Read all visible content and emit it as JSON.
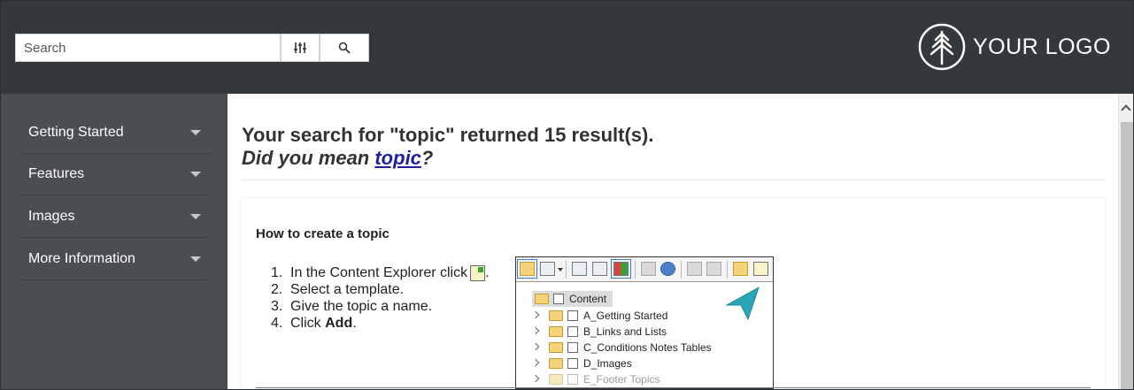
{
  "header": {
    "search": {
      "placeholder": "Search"
    },
    "logo_text": "YOUR LOGO",
    "icons": {
      "filter": "sliders-icon",
      "search": "search-icon",
      "logo": "tree-logo-icon"
    }
  },
  "sidebar": {
    "items": [
      {
        "label": "Getting Started"
      },
      {
        "label": "Features"
      },
      {
        "label": "Images"
      },
      {
        "label": "More Information"
      }
    ]
  },
  "results": {
    "heading": "Your search for \"topic\" returned 15 result(s).",
    "did_you_mean_prefix": "Did you mean ",
    "did_you_mean_term": "topic",
    "did_you_mean_suffix": "?",
    "card": {
      "title": "How to create a topic",
      "steps": [
        {
          "num": "1.",
          "text": "In the Content Explorer click"
        },
        {
          "num": "2.",
          "text": "Select a template."
        },
        {
          "num": "3.",
          "text": "Give the topic a name."
        },
        {
          "num": "4.",
          "text_prefix": "Click ",
          "text_bold": "Add",
          "text_suffix": "."
        }
      ],
      "step1_suffix": ".",
      "explorer": {
        "root": "Content",
        "folders": [
          {
            "name": "A_Getting Started"
          },
          {
            "name": "B_Links and Lists"
          },
          {
            "name": "C_Conditions Notes Tables"
          },
          {
            "name": "D_Images"
          },
          {
            "name": "E_Footer Topics"
          }
        ]
      }
    }
  },
  "colors": {
    "header_bg": "#34373b",
    "sidebar_bg": "#4a4d51",
    "link": "#1f1fa0",
    "pointer": "#2aa5b8"
  }
}
